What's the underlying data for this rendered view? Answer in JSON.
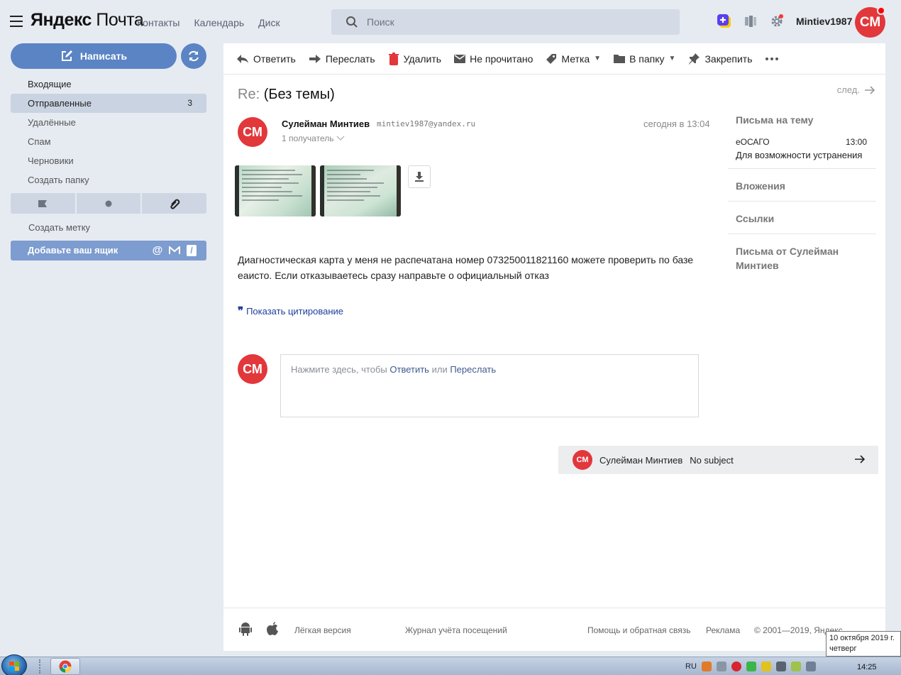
{
  "app": {
    "logo_brand": "Яндекс",
    "logo_product": "Почта",
    "nav": [
      "Контакты",
      "Календарь",
      "Диск"
    ],
    "search_placeholder": "Поиск",
    "username": "Mintiev1987",
    "avatar_initials": "СМ"
  },
  "sidebar": {
    "compose_label": "Написать",
    "folders": [
      {
        "label": "Входящие",
        "count": ""
      },
      {
        "label": "Отправленные",
        "count": "3"
      },
      {
        "label": "Удалённые",
        "count": ""
      },
      {
        "label": "Спам",
        "count": ""
      },
      {
        "label": "Черновики",
        "count": ""
      },
      {
        "label": "Создать папку",
        "count": ""
      }
    ],
    "create_label": "Создать метку",
    "add_mailbox": "Добавьте ваш ящик"
  },
  "toolbar": {
    "reply": "Ответить",
    "forward": "Переслать",
    "delete": "Удалить",
    "unread": "Не прочитано",
    "label": "Метка",
    "move": "В папку",
    "pin": "Закрепить"
  },
  "message": {
    "subject_prefix": "Re:",
    "subject": "(Без темы)",
    "next_label": "след.",
    "sender_name": "Сулейман Минтиев",
    "sender_email": "mintiev1987@yandex.ru",
    "recipients": "1 получатель",
    "date": "сегодня в 13:04",
    "body": "Диагностическая карта у меня не распечатана номер 073250011821160 можете проверить по базе еаисто. Если отказываетесь сразу направьте о официальный отказ",
    "show_quote": "Показать цитирование",
    "reply_hint_prefix": "Нажмите здесь, чтобы",
    "reply_link": "Ответить",
    "reply_or": "или",
    "forward_link": "Переслать"
  },
  "next_message": {
    "initials": "СМ",
    "sender": "Сулейман Минтиев",
    "subject": "No subject"
  },
  "right_panel": {
    "thread_title": "Письма на тему",
    "thread_item_subject": "еОСАГО",
    "thread_item_time": "13:00",
    "thread_item_snippet": "Для возможности устранения",
    "attachments": "Вложения",
    "links": "Ссылки",
    "from_sender": "Письма от Сулейман Минтиев"
  },
  "footer": {
    "light": "Лёгкая версия",
    "journal": "Журнал учёта посещений",
    "help": "Помощь и обратная связь",
    "ads": "Реклама",
    "copyright": "© 2001—2019, Яндекс"
  },
  "taskbar": {
    "lang": "RU",
    "time": "14:25",
    "tooltip_date": "10 октября 2019 г.",
    "tooltip_day": "четверг"
  },
  "colors": {
    "accent": "#5b84c4",
    "avatar": "#e2373b",
    "link": "#1e3c9c"
  }
}
